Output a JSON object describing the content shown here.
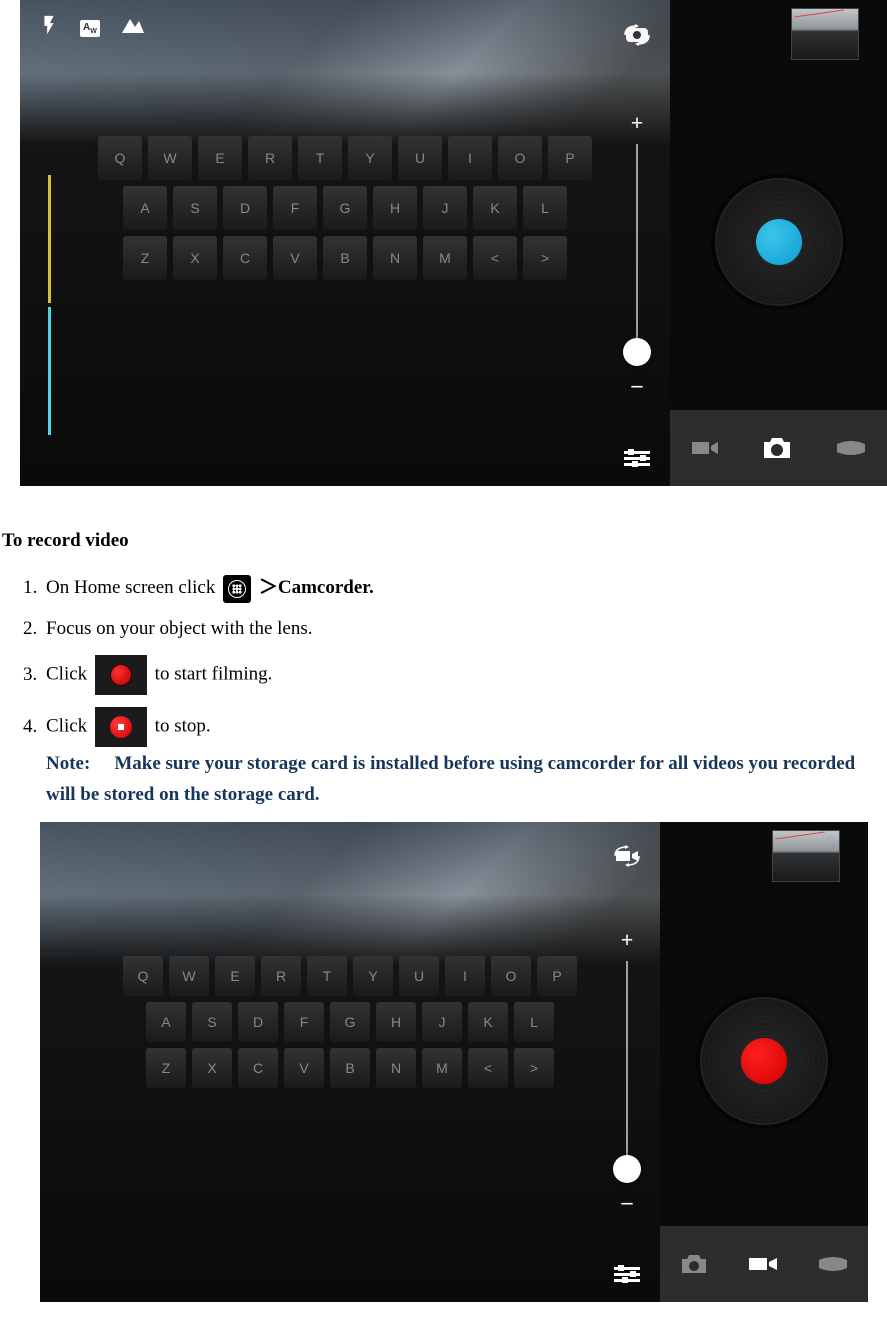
{
  "section_title": "To record video",
  "steps": {
    "s1a": "On Home screen click ",
    "s1b": "＞",
    "s1c": "Camcorder.",
    "s2": "Focus on your object with the lens.",
    "s3a": "Click ",
    "s3b": " to start filming.",
    "s4a": "Click ",
    "s4b": " to stop."
  },
  "note": {
    "label": "Note:",
    "body": "Make sure your storage card is installed before using camcorder for all videos you recorded will be stored on the storage card."
  },
  "zoom": {
    "plus": "+",
    "minus": "–"
  },
  "keyboard_row1": [
    "Q",
    "W",
    "E",
    "R",
    "T",
    "Y",
    "U",
    "I",
    "O",
    "P"
  ],
  "keyboard_row2": [
    "A",
    "S",
    "D",
    "F",
    "G",
    "H",
    "J",
    "K",
    "L"
  ],
  "keyboard_row3": [
    "Z",
    "X",
    "C",
    "V",
    "B",
    "N",
    "M",
    "<",
    ">"
  ]
}
